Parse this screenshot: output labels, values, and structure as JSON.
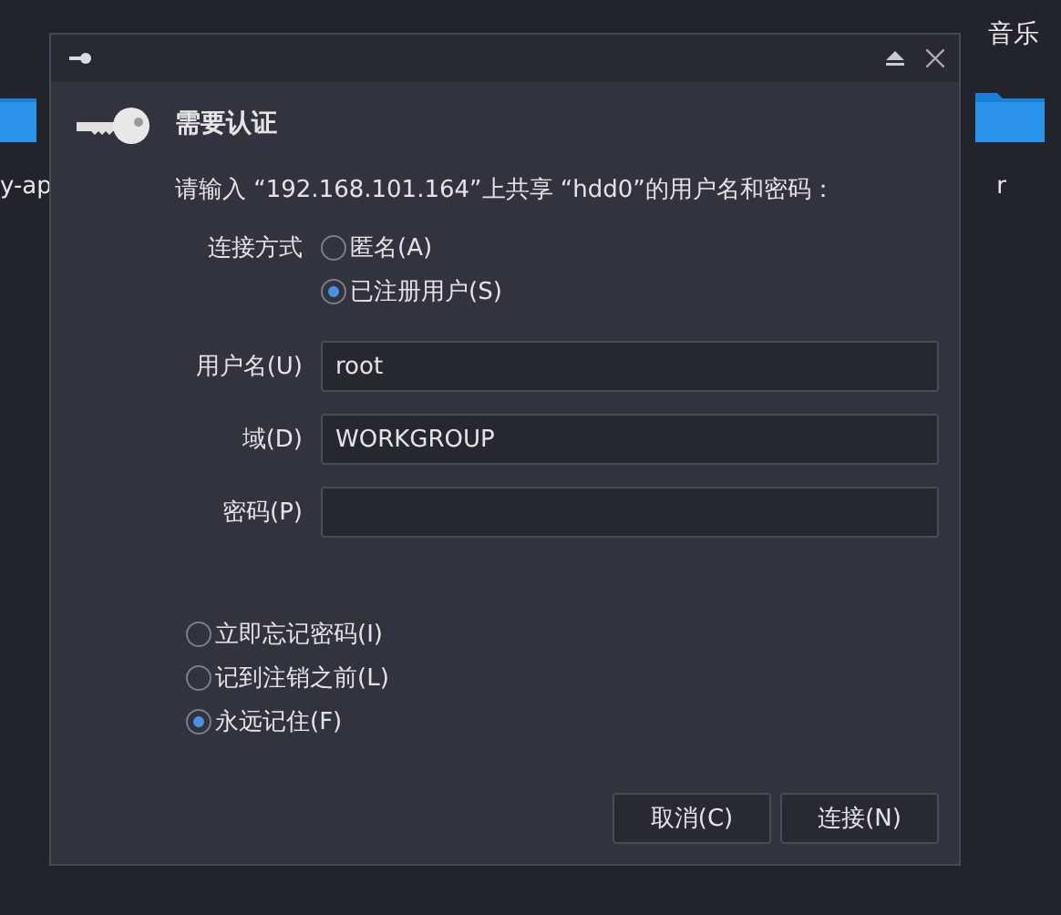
{
  "desktop": {
    "labels": [
      {
        "text": "音乐"
      }
    ],
    "file_names": [
      {
        "text": "y-ap"
      },
      {
        "text": "r"
      }
    ]
  },
  "dialog": {
    "heading": "需要认证",
    "message": "请输入 “192.168.101.164”上共享 “hdd0”的用户名和密码：",
    "connect_label": "连接方式",
    "connect_options": [
      {
        "label": "匿名(A)",
        "selected": false
      },
      {
        "label": "已注册用户(S)",
        "selected": true
      }
    ],
    "fields": [
      {
        "label": "用户名(U)",
        "value": "root"
      },
      {
        "label": "域(D)",
        "value": "WORKGROUP"
      },
      {
        "label": "密码(P)"
      }
    ],
    "remember_options": [
      {
        "label": "立即忘记密码(I)",
        "selected": false
      },
      {
        "label": "记到注销之前(L)",
        "selected": false
      },
      {
        "label": "永远记住(F)",
        "selected": true
      }
    ],
    "buttons": [
      "取消(C)",
      "连接(N)"
    ]
  }
}
